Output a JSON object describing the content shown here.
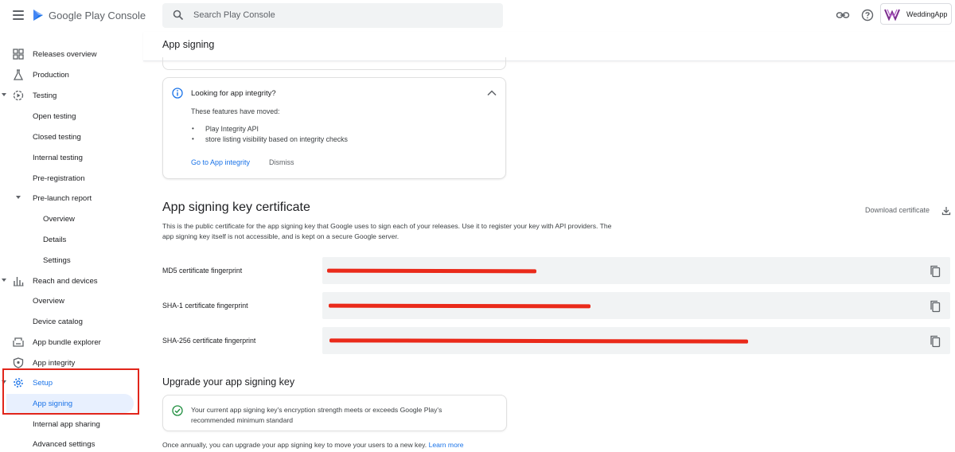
{
  "app": {
    "brand": "Google Play Console",
    "search_placeholder": "Search Play Console",
    "app_name": "WeddingApp"
  },
  "page": {
    "title": "App signing"
  },
  "sidebar": {
    "releases_overview": "Releases overview",
    "production": "Production",
    "testing": "Testing",
    "open_testing": "Open testing",
    "closed_testing": "Closed testing",
    "internal_testing": "Internal testing",
    "pre_registration": "Pre-registration",
    "pre_launch_report": "Pre-launch report",
    "pl_overview": "Overview",
    "pl_details": "Details",
    "pl_settings": "Settings",
    "reach_and_devices": "Reach and devices",
    "rd_overview": "Overview",
    "device_catalog": "Device catalog",
    "app_bundle_explorer": "App bundle explorer",
    "app_integrity": "App integrity",
    "setup": "Setup",
    "app_signing": "App signing",
    "internal_app_sharing": "Internal app sharing",
    "advanced_settings": "Advanced settings"
  },
  "integrity_card": {
    "title": "Looking for app integrity?",
    "subtitle": "These features have moved:",
    "bullets": [
      "Play Integrity API",
      "store listing visibility based on integrity checks"
    ],
    "link": "Go to App integrity",
    "dismiss": "Dismiss"
  },
  "certificate": {
    "title": "App signing key certificate",
    "download": "Download certificate",
    "description": "This is the public certificate for the app signing key that Google uses to sign each of your releases. Use it to register your key with API providers. The app signing key itself is not accessible, and is kept on a secure Google server.",
    "fingerprints": [
      {
        "label": "MD5 certificate fingerprint",
        "value": ""
      },
      {
        "label": "SHA-1 certificate fingerprint",
        "value": ""
      },
      {
        "label": "SHA-256 certificate fingerprint",
        "value": ""
      }
    ]
  },
  "upgrade": {
    "title": "Upgrade your app signing key",
    "status": "Your current app signing key's encryption strength meets or exceeds Google Play's recommended minimum standard",
    "footer": "Once annually, you can upgrade your app signing key to move your users to a new key.",
    "learn_more": "Learn more"
  },
  "colors": {
    "accent": "#1a73e8",
    "highlight": "#e1251b",
    "redaction": "#ea2a1a",
    "success": "#1e8e3e"
  }
}
